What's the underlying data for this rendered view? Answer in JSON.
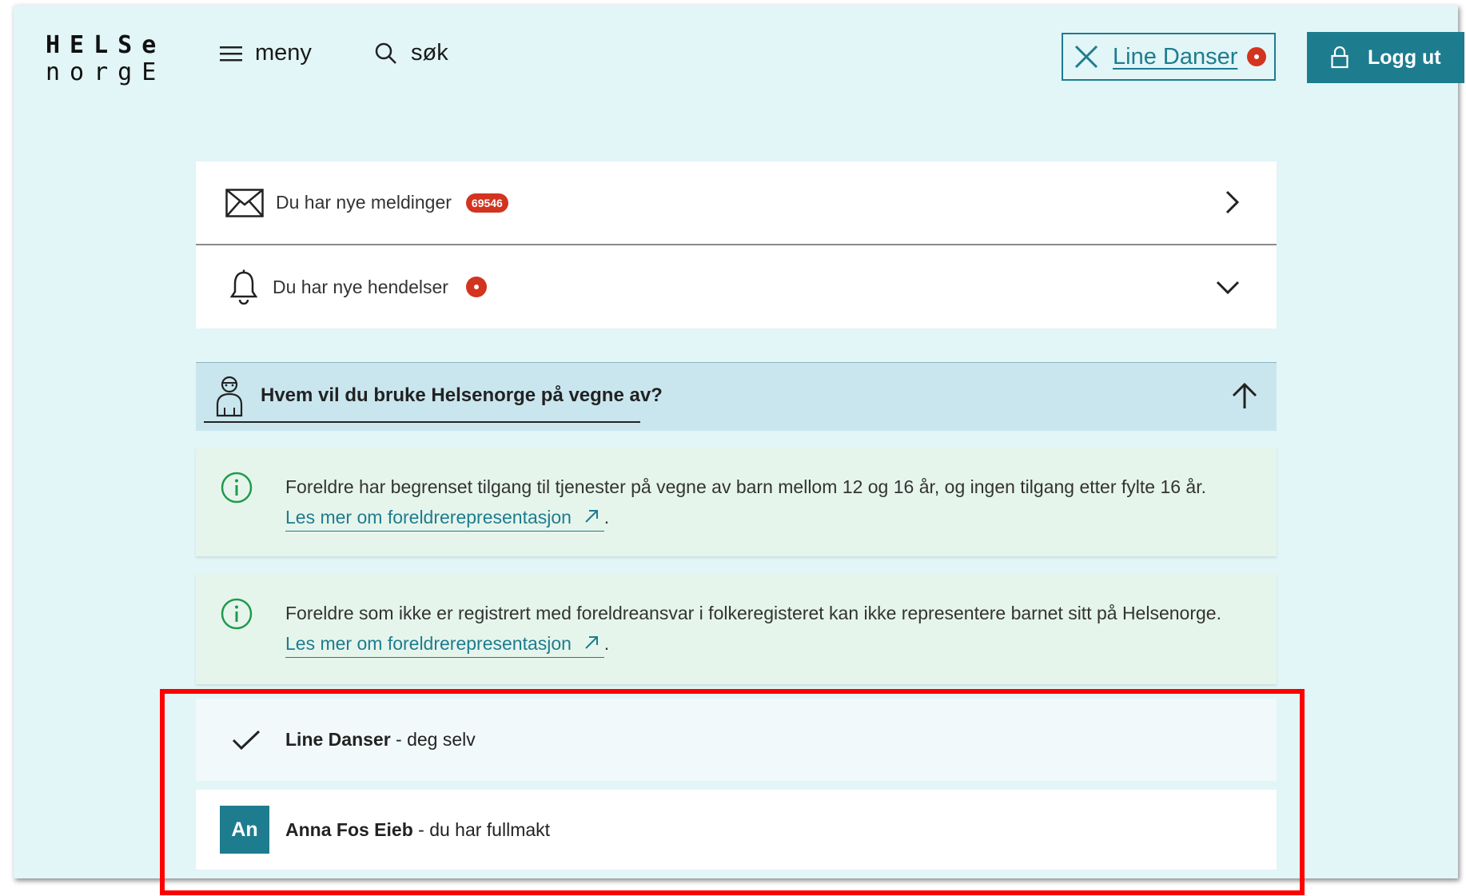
{
  "header": {
    "logo_line1": "HELSe",
    "logo_line2": "norgE",
    "menu_label": "meny",
    "search_label": "søk",
    "user_name": "Line Danser",
    "logout_label": "Logg ut"
  },
  "notifications": {
    "messages_text": "Du har nye meldinger",
    "messages_count": "69546",
    "events_text": "Du har nye hendelser"
  },
  "representation": {
    "title": "Hvem vil du bruke Helsenorge på vegne av?",
    "info1_text": "Foreldre har begrenset tilgang til tjenester på vegne av barn mellom 12 og 16 år, og ingen tilgang etter fylte 16 år.",
    "info1_link": "Les mer om foreldrerepresentasjon",
    "info2_text": "Foreldre som ikke er registrert med foreldreansvar i folkeregisteret kan ikke representere barnet sitt på Helsenorge.",
    "info2_link": "Les mer om foreldrerepresentasjon",
    "people": [
      {
        "name": "Line Danser",
        "relation": " - deg selv"
      },
      {
        "initials": "An",
        "name": "Anna Fos Eieb",
        "relation": " - du har fullmakt"
      }
    ]
  },
  "colors": {
    "accent": "#1e7c8f",
    "alert": "#d2341f",
    "background": "#e2f5f7",
    "highlight": "#ff0000"
  }
}
